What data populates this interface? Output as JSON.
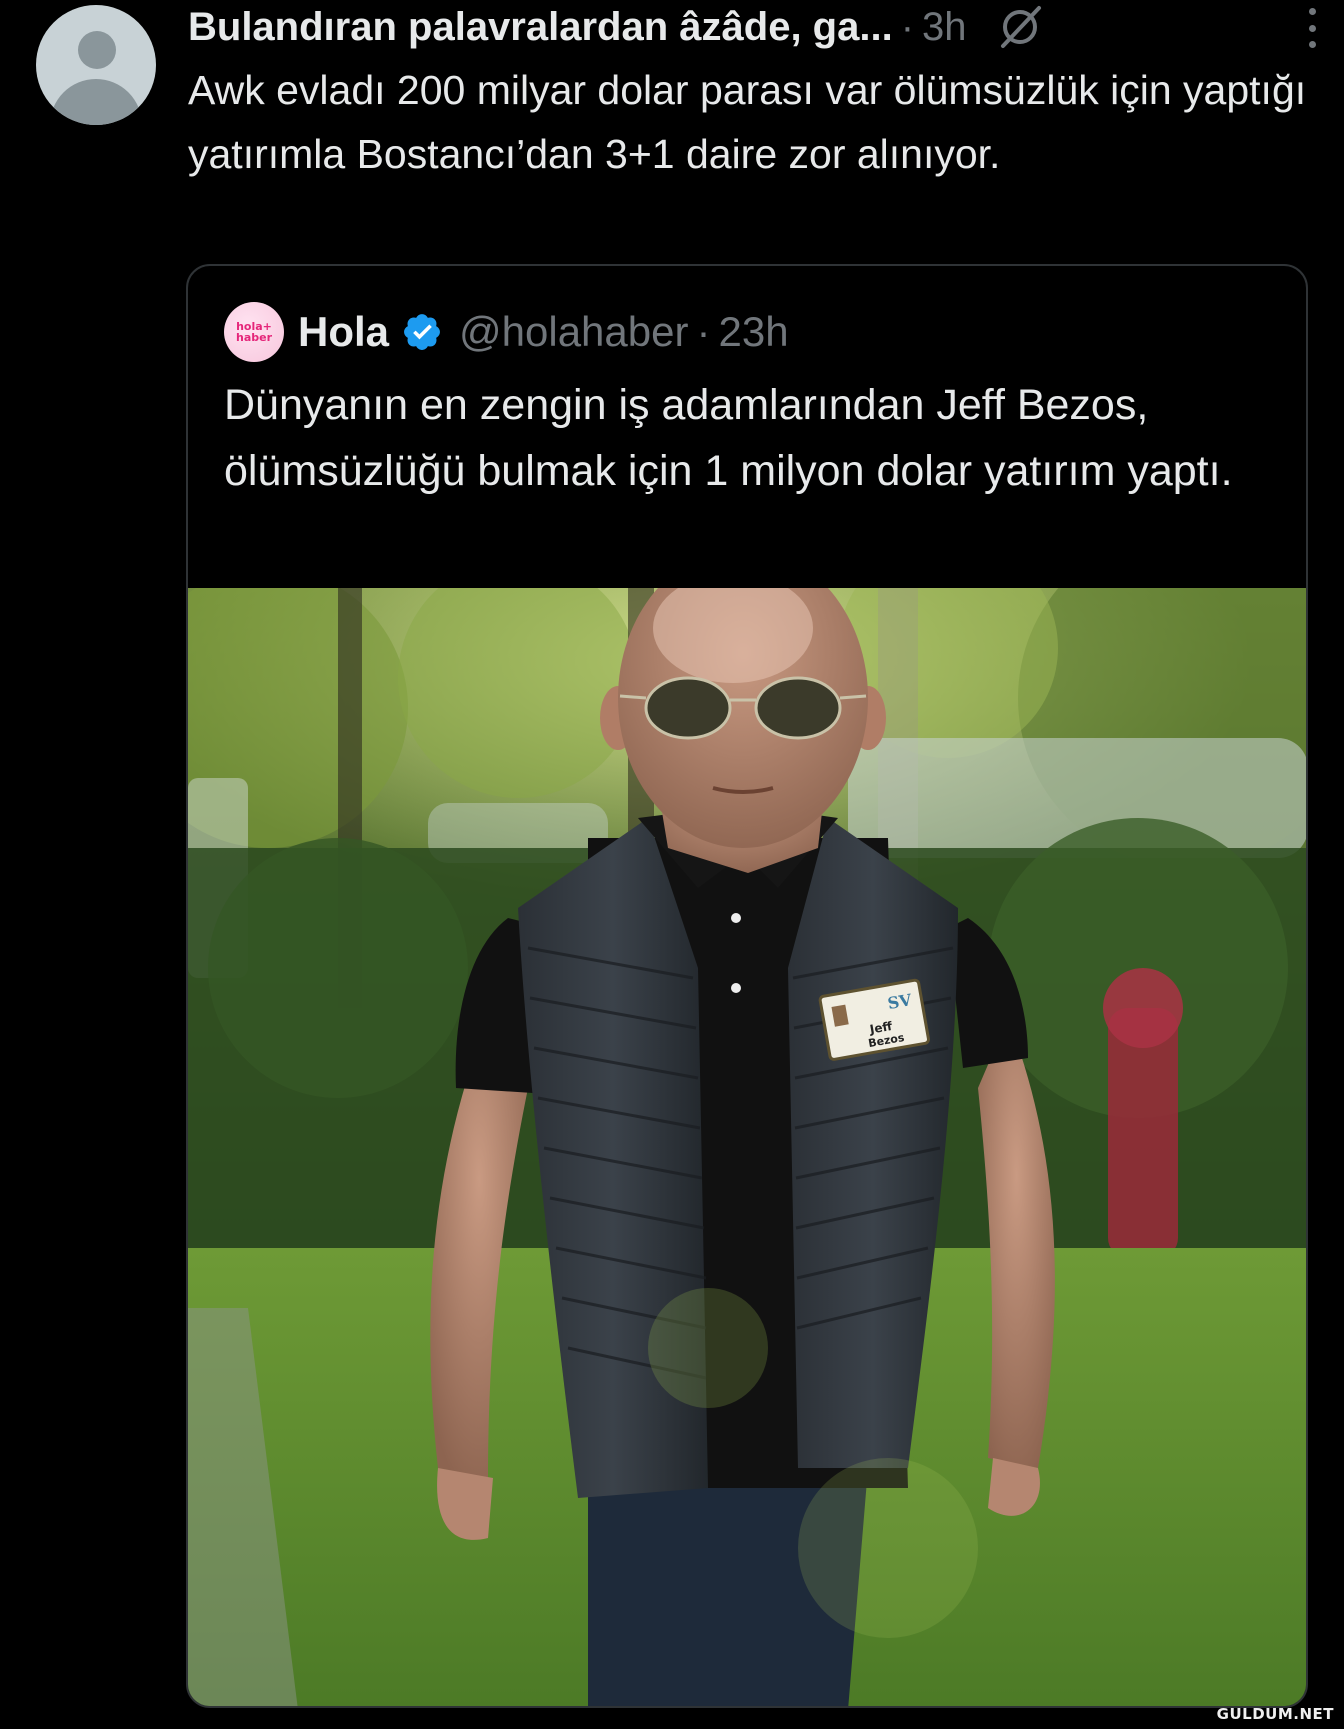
{
  "tweet": {
    "display_name": "Bulandıran palavralardan âzâde, ga...",
    "separator": "·",
    "time": "3h",
    "text": "Awk evladı 200 milyar dolar parası var  ölümsüzlük için yaptığı yatırımla Bostancı’dan 3+1 daire zor alınıyor."
  },
  "quoted_tweet": {
    "avatar_text_line1": "hola+",
    "avatar_text_line2": "haber",
    "display_name": "Hola",
    "handle": "@holahaber",
    "separator": "·",
    "time": "23h",
    "text": "Dünyanın en zengin iş adamlarından Jeff Bezos, ölümsüzlüğü bulmak için 1 milyon dolar yatırım yaptı.",
    "photo_badge_line1": "Jeff",
    "photo_badge_line2": "Bezos",
    "photo_badge_logo": "SV"
  },
  "watermark": "GULDUM.NET",
  "colors": {
    "background": "#000000",
    "text_primary": "#e7e9ea",
    "text_secondary": "#71767b",
    "border": "#2f3336",
    "verified": "#1d9bf0"
  },
  "icons": {
    "more": "more-icon",
    "grok": "grok-icon",
    "verified": "verified-badge-icon"
  }
}
